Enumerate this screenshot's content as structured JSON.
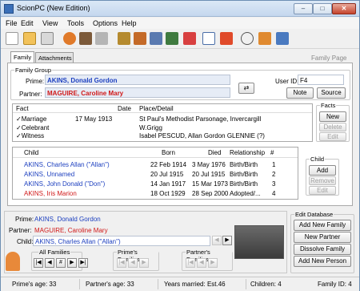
{
  "window": {
    "title": "ScionPC (New Edition)",
    "min": "–",
    "max": "□",
    "close": "✕"
  },
  "menu": [
    "File",
    "Edit",
    "View",
    "Tools",
    "Options",
    "Help"
  ],
  "toolbar": [
    "new-icon",
    "open-icon",
    "print-icon",
    "person-icon",
    "family-icon",
    "tree-icon",
    "book-icon",
    "report-icon",
    "library-icon",
    "export-icon",
    "save-icon",
    "home-icon",
    "search-icon",
    "people-icon",
    "calendar-icon"
  ],
  "tabs": [
    "Family",
    "Attachments"
  ],
  "page_hint": "Family Page",
  "family_group": {
    "legend": "Family Group",
    "prime_label": "Prime:",
    "prime": "AKINS, Donald Gordon",
    "partner_label": "Partner:",
    "partner": "MAGUIRE, Caroline Mary",
    "userid_label": "User ID:",
    "userid": "F4",
    "note": "Note",
    "source": "Source"
  },
  "facts": {
    "headers": [
      "Fact",
      "Date",
      "Place/Detail"
    ],
    "rows": [
      {
        "fact": "✓Marriage",
        "date": "17 May 1913",
        "detail": "St Paul's Methodist Parsonage, Invercargill"
      },
      {
        "fact": "✓Celebrant",
        "date": "",
        "detail": "W.Grigg"
      },
      {
        "fact": "✓Witness",
        "date": "",
        "detail": "Isabel PESCUD, Allan Gordon GLENNIE (?)"
      }
    ],
    "legend": "Facts",
    "new": "New",
    "delete": "Delete",
    "edit": "Edit"
  },
  "children": {
    "headers": [
      "Child",
      "Born",
      "Died",
      "Relationship",
      "#"
    ],
    "rows": [
      {
        "name": "AKINS, Charles Allan (\"Allan\")",
        "born": "22 Feb 1914",
        "died": "3 May 1976",
        "rel": "Birth/Birth",
        "num": "1",
        "color": "#1c3fbf"
      },
      {
        "name": "AKINS, Unnamed",
        "born": "20 Jul 1915",
        "died": "20 Jul 1915",
        "rel": "Birth/Birth",
        "num": "2",
        "color": "#1c3fbf"
      },
      {
        "name": "AKINS, John Donald (\"Don\")",
        "born": "14 Jan 1917",
        "died": "15 Mar 1973",
        "rel": "Birth/Birth",
        "num": "3",
        "color": "#1c3fbf"
      },
      {
        "name": "AKINS, Iris Marion",
        "born": "18 Oct 1929",
        "died": "28 Sep 2000",
        "rel": "Adopted/...",
        "num": "4",
        "color": "#d01818"
      }
    ],
    "legend": "Child",
    "add": "Add",
    "remove": "Remove",
    "edit": "Edit"
  },
  "bottom": {
    "prime_label": "Prime:",
    "prime": "AKINS, Donald Gordon",
    "partner_label": "Partner:",
    "partner": "MAGUIRE, Caroline Mary",
    "child_label": "Child:",
    "child": "AKINS, Charles Allan (\"Allan\")"
  },
  "nav": {
    "all": "All Families",
    "primes": "Prime's Families",
    "partners": "Partner's Families"
  },
  "edit_db": {
    "legend": "Edit Database",
    "add_family": "Add New Family",
    "new_partner": "New Partner",
    "dissolve": "Dissolve Family",
    "add_person": "Add New Person"
  },
  "status": {
    "prime_age": "Prime's age: 33",
    "partner_age": "Partner's age: 33",
    "years": "Years married: Est.46",
    "children": "Children: 4",
    "family_id": "Family ID: 4"
  }
}
